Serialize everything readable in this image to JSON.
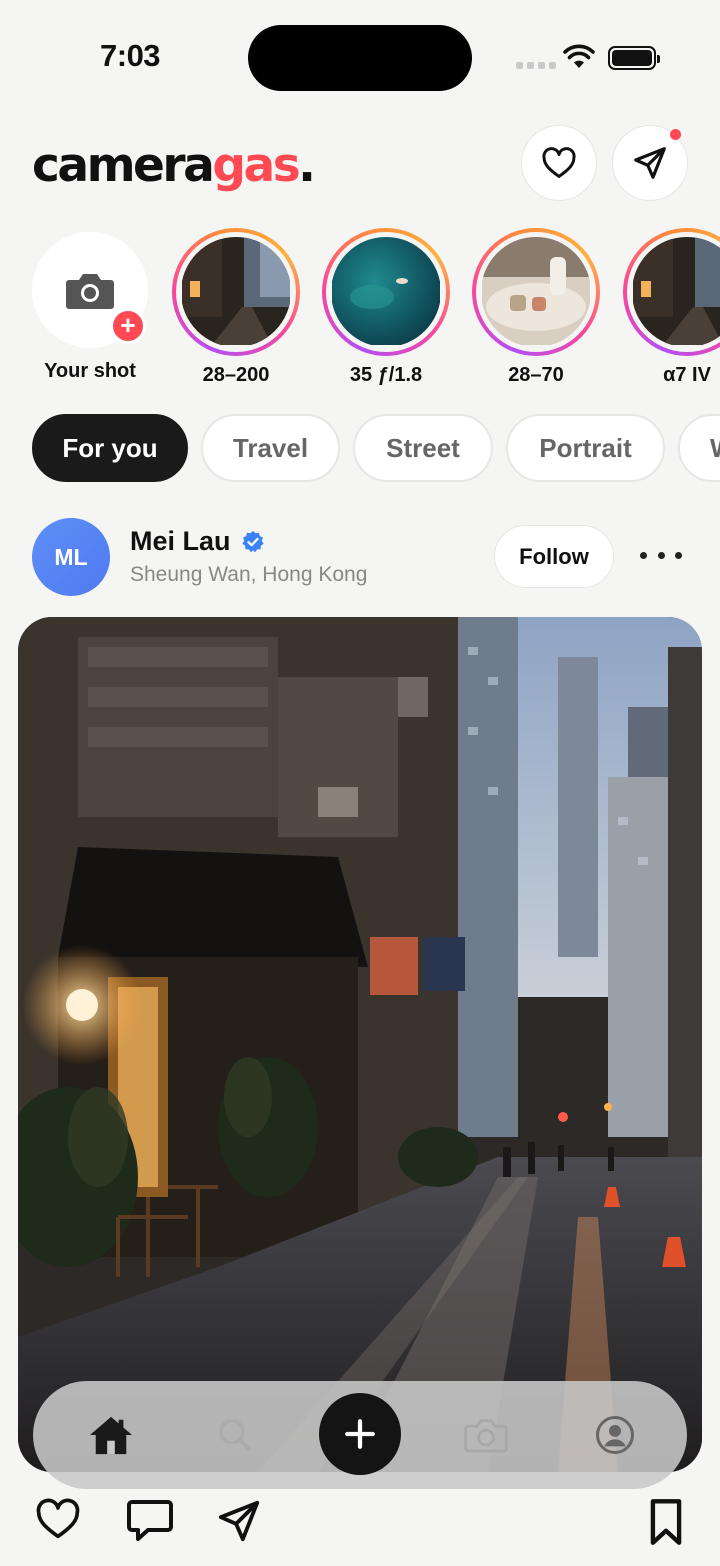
{
  "status": {
    "time": "7:03"
  },
  "app": {
    "logo_part1": "camera",
    "logo_part2": "gas",
    "logo_part3": "."
  },
  "stories": {
    "your_label": "Your shot",
    "items": [
      {
        "label": "28–200"
      },
      {
        "label": "35 ƒ/1.8"
      },
      {
        "label": "28–70"
      },
      {
        "label": "α7 IV"
      }
    ]
  },
  "filters": [
    "For you",
    "Travel",
    "Street",
    "Portrait",
    "W"
  ],
  "post": {
    "avatar_initials": "ML",
    "author": "Mei Lau",
    "location": "Sheung Wan, Hong Kong",
    "follow_label": "Follow"
  },
  "colors": {
    "accent": "#ff4a54",
    "dark": "#141414",
    "avatar": "#5e8ff7",
    "verified": "#3b82f6"
  }
}
